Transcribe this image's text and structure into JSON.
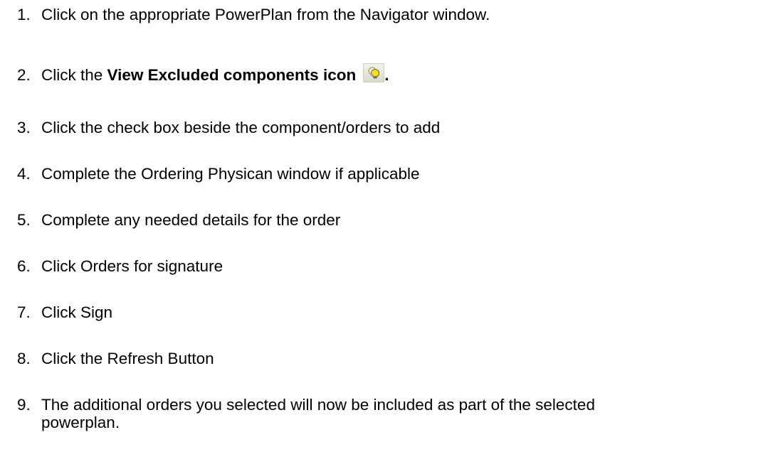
{
  "steps": [
    {
      "num": "1.",
      "text": "Click on the appropriate PowerPlan from the Navigator window."
    },
    {
      "num": "2.",
      "prefix": "Click the ",
      "bold": "View Excluded components icon",
      "suffix": ".",
      "icon": "view-excluded-components-icon"
    },
    {
      "num": "3.",
      "text": "Click the check box beside the component/orders to add"
    },
    {
      "num": "4.",
      "text": "Complete the Ordering Physican window if applicable"
    },
    {
      "num": "5.",
      "text": "Complete any needed details for the order"
    },
    {
      "num": "6.",
      "text": "Click Orders for signature"
    },
    {
      "num": "7.",
      "text": "Click Sign"
    },
    {
      "num": "8.",
      "text": "Click the Refresh Button"
    },
    {
      "num": "9.",
      "text": "The additional orders you selected will now be included as part of the selected",
      "text_cont": "powerplan."
    }
  ]
}
